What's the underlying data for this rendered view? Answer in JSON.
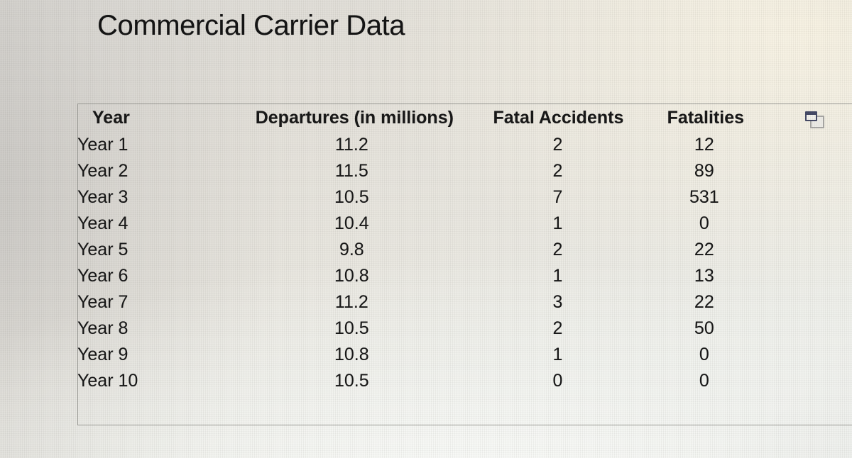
{
  "page": {
    "title": "Commercial Carrier Data"
  },
  "table": {
    "columns": [
      {
        "key": "year",
        "label": "Year"
      },
      {
        "key": "departures",
        "label": "Departures (in millions)"
      },
      {
        "key": "accidents",
        "label": "Fatal Accidents"
      },
      {
        "key": "fatalities",
        "label": "Fatalities"
      }
    ],
    "rows": [
      {
        "year": "Year 1",
        "departures": "11.2",
        "accidents": "2",
        "fatalities": "12"
      },
      {
        "year": "Year 2",
        "departures": "11.5",
        "accidents": "2",
        "fatalities": "89"
      },
      {
        "year": "Year 3",
        "departures": "10.5",
        "accidents": "7",
        "fatalities": "531"
      },
      {
        "year": "Year 4",
        "departures": "10.4",
        "accidents": "1",
        "fatalities": "0"
      },
      {
        "year": "Year 5",
        "departures": "9.8",
        "accidents": "2",
        "fatalities": "22"
      },
      {
        "year": "Year 6",
        "departures": "10.8",
        "accidents": "1",
        "fatalities": "13"
      },
      {
        "year": "Year 7",
        "departures": "11.2",
        "accidents": "3",
        "fatalities": "22"
      },
      {
        "year": "Year 8",
        "departures": "10.5",
        "accidents": "2",
        "fatalities": "50"
      },
      {
        "year": "Year 9",
        "departures": "10.8",
        "accidents": "1",
        "fatalities": "0"
      },
      {
        "year": "Year 10",
        "departures": "10.5",
        "accidents": "0",
        "fatalities": "0"
      }
    ],
    "tools": {
      "duplicate_icon": "duplicate-window-icon"
    }
  },
  "chart_data": {
    "type": "table",
    "title": "Commercial Carrier Data",
    "columns": [
      "Year",
      "Departures (in millions)",
      "Fatal Accidents",
      "Fatalities"
    ],
    "rows": [
      [
        "Year 1",
        "11.2",
        "2",
        "12"
      ],
      [
        "Year 2",
        "11.5",
        "2",
        "89"
      ],
      [
        "Year 3",
        "10.5",
        "7",
        "531"
      ],
      [
        "Year 4",
        "10.4",
        "1",
        "0"
      ],
      [
        "Year 5",
        "9.8",
        "2",
        "22"
      ],
      [
        "Year 6",
        "10.8",
        "1",
        "13"
      ],
      [
        "Year 7",
        "11.2",
        "3",
        "22"
      ],
      [
        "Year 8",
        "10.5",
        "2",
        "50"
      ],
      [
        "Year 9",
        "10.8",
        "1",
        "0"
      ],
      [
        "Year 10",
        "10.5",
        "0",
        "0"
      ]
    ],
    "series": [
      {
        "name": "Departures (in millions)",
        "values": [
          11.2,
          11.5,
          10.5,
          10.4,
          9.8,
          10.8,
          11.2,
          10.5,
          10.8,
          10.5
        ]
      },
      {
        "name": "Fatal Accidents",
        "values": [
          2,
          2,
          7,
          1,
          2,
          1,
          3,
          2,
          1,
          0
        ]
      },
      {
        "name": "Fatalities",
        "values": [
          12,
          89,
          531,
          0,
          22,
          13,
          22,
          50,
          0,
          0
        ]
      }
    ],
    "categories": [
      "Year 1",
      "Year 2",
      "Year 3",
      "Year 4",
      "Year 5",
      "Year 6",
      "Year 7",
      "Year 8",
      "Year 9",
      "Year 10"
    ],
    "xlabel": "Year",
    "ylabel": "",
    "grid": false
  },
  "theme": {
    "text_color": "#181818",
    "border_color": "#9b9b96",
    "icon_front_color": "#454a66",
    "icon_back_color": "#a9a8a6"
  }
}
